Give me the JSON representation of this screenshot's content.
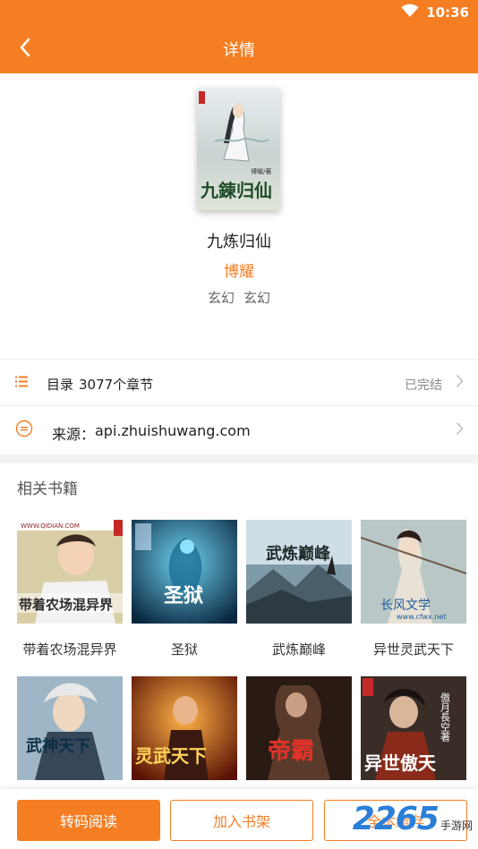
{
  "status": {
    "time": "10:36"
  },
  "header": {
    "title": "详情"
  },
  "book": {
    "cover_title": "九錬归仙",
    "cover_author": "博耀/著",
    "title": "九炼归仙",
    "author": "博耀",
    "tags": [
      "玄幻",
      "玄幻"
    ]
  },
  "catalog": {
    "label": "目录",
    "count": "3077个章节",
    "status": "已完结"
  },
  "source": {
    "prefix": "来源：",
    "url": "api.zhuishuwang.com"
  },
  "related": {
    "title": "相关书籍",
    "items": [
      {
        "name": "带着农场混异界",
        "cover_text": "带着农场混异界",
        "cover_top": "WWW.QIDIAN.COM"
      },
      {
        "name": "圣狱",
        "cover_text": "圣狱",
        "cover_top": ""
      },
      {
        "name": "武炼巅峰",
        "cover_text": "武炼巅峰",
        "cover_top": ""
      },
      {
        "name": "异世灵武天下",
        "cover_text": "长风文学",
        "cover_top": "www.cfwx.net"
      },
      {
        "name": "",
        "cover_text": "武神天下",
        "cover_top": ""
      },
      {
        "name": "",
        "cover_text": "灵武天下",
        "cover_top": ""
      },
      {
        "name": "",
        "cover_text": "帝霸",
        "cover_top": ""
      },
      {
        "name": "",
        "cover_text": "异世傲天",
        "cover_top": "傲月長空著"
      }
    ]
  },
  "actions": {
    "read": "转码阅读",
    "shelf": "加入书架",
    "cache": "全本缓存"
  },
  "watermark": {
    "num": "2265",
    "text": "手游网"
  },
  "colors": {
    "accent": "#f57e23",
    "page": "#ffffff",
    "divider": "#f2f2f2"
  }
}
